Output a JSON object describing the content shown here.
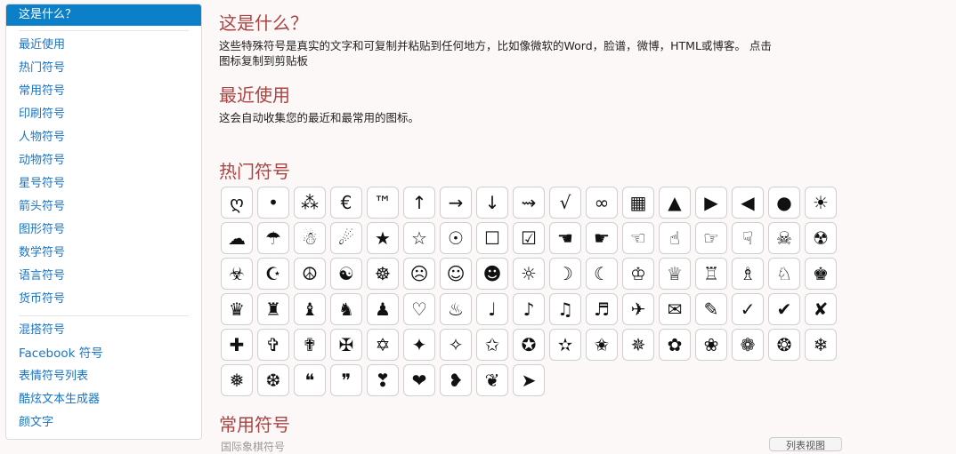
{
  "sidebar": {
    "active": "这是什么？",
    "groups": [
      [
        "最近使用",
        "热门符号",
        "常用符号",
        "印刷符号",
        "人物符号",
        "动物符号",
        "星号符号",
        "箭头符号",
        "图形符号",
        "数学符号",
        "语言符号",
        "货币符号"
      ],
      [
        "混搭符号",
        "Facebook 符号",
        "表情符号列表",
        "酷炫文本生成器",
        "颜文字"
      ]
    ]
  },
  "main": {
    "what_title": "这是什么？",
    "what_desc_1": "这些特殊符号是真实的文字和可复制并粘贴到任何地方，比如像微软的Word，脸谱，微博，HTML或博客。 点击",
    "what_desc_2": "图标复制到剪贴板",
    "recent_title": "最近使用",
    "recent_desc": "这会自动收集您的最近和最常用的图标。",
    "popular_title": "热门符号",
    "common_title": "常用符号",
    "common_sub": "国际象棋符号",
    "common_button": "列表视图"
  },
  "symbols": [
    "ღ",
    "•",
    "⁂",
    "€",
    "™",
    "↑",
    "→",
    "↓",
    "⇝",
    "√",
    "∞",
    "▦",
    "▲",
    "▶",
    "◀",
    "●",
    "☀",
    "☁",
    "☂",
    "☃",
    "☄",
    "★",
    "☆",
    "☉",
    "☐",
    "☑",
    "☚",
    "☛",
    "☜",
    "☝",
    "☞",
    "☟",
    "☠",
    "☢",
    "☣",
    "☪",
    "☮",
    "☯",
    "☸",
    "☹",
    "☺",
    "☻",
    "☼",
    "☽",
    "☾",
    "♔",
    "♕",
    "♖",
    "♗",
    "♘",
    "♚",
    "♛",
    "♜",
    "♝",
    "♞",
    "♟",
    "♡",
    "♨",
    "♩",
    "♪",
    "♫",
    "♬",
    "✈",
    "✉",
    "✎",
    "✓",
    "✔",
    "✘",
    "✚",
    "✞",
    "✟",
    "✠",
    "✡",
    "✦",
    "✧",
    "✩",
    "✪",
    "✫",
    "✬",
    "✵",
    "✿",
    "❀",
    "❁",
    "❂",
    "❄",
    "❅",
    "❆",
    "❝",
    "❞",
    "❣",
    "❤",
    "❥",
    "❦",
    "➤"
  ]
}
